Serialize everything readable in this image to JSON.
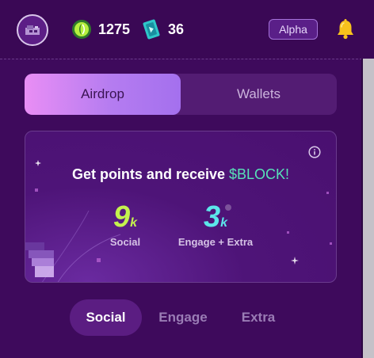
{
  "header": {
    "points": "1275",
    "tickets": "36",
    "badge": "Alpha",
    "icons": [
      "avatar-icon",
      "points-icon",
      "ticket-icon",
      "bell-icon"
    ]
  },
  "tabs": {
    "airdrop_label": "Airdrop",
    "wallets_label": "Wallets",
    "selected": "Airdrop"
  },
  "card": {
    "title_prefix": "Get points and receive ",
    "title_token": "$BLOCK!",
    "social": {
      "number": "9",
      "unit": "k",
      "label": "Social"
    },
    "engage": {
      "number": "3",
      "unit": "k",
      "label": "Engage + Extra"
    }
  },
  "subtabs": {
    "social_label": "Social",
    "engage_label": "Engage",
    "extra_label": "Extra",
    "selected": "Social"
  },
  "colors": {
    "background": "#3e0a5c",
    "accent_green": "#c4f24e",
    "accent_cyan": "#5ce6ea",
    "token_color": "#57e3b8"
  }
}
